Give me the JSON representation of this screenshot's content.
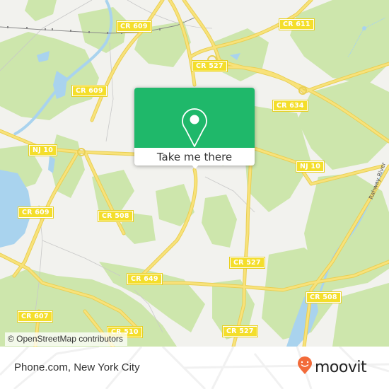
{
  "map": {
    "attribution": "© OpenStreetMap contributors",
    "road_labels": [
      {
        "id": "cr609-top",
        "text": "CR 609"
      },
      {
        "id": "cr611",
        "text": "CR 611"
      },
      {
        "id": "cr527-top",
        "text": "CR 527"
      },
      {
        "id": "cr609-mid",
        "text": "CR 609"
      },
      {
        "id": "cr634",
        "text": "CR 634"
      },
      {
        "id": "nj10-left",
        "text": "NJ 10"
      },
      {
        "id": "nj10-right",
        "text": "NJ 10"
      },
      {
        "id": "cr609-left",
        "text": "CR 609"
      },
      {
        "id": "cr508-left",
        "text": "CR 508"
      },
      {
        "id": "cr527-mid",
        "text": "CR 527"
      },
      {
        "id": "cr649",
        "text": "CR 649"
      },
      {
        "id": "cr508-right",
        "text": "CR 508"
      },
      {
        "id": "cr607",
        "text": "CR 607"
      },
      {
        "id": "cr527-bottom",
        "text": "CR 527"
      },
      {
        "id": "cr510",
        "text": "CR 510"
      }
    ],
    "river_label": "Rahway River",
    "colors": {
      "land": "#f2f2ee",
      "park": "#cde6ac",
      "water": "#a9d3ee",
      "road": "#f7df5e",
      "label": "#f4de2b"
    }
  },
  "popup": {
    "icon": "map-pin-icon",
    "button_label": "Take me there",
    "accent_color": "#1fb86a"
  },
  "footer": {
    "place_name": "Phone.com, New York City",
    "brand": "moovit",
    "brand_icon": "moovit-smile-pin-icon",
    "brand_color": "#f26b3a"
  }
}
